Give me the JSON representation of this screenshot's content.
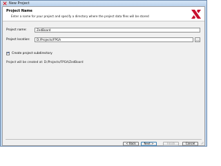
{
  "window": {
    "title": "New Project",
    "icon": "xilinx-ise-icon"
  },
  "header": {
    "title": "Project Name",
    "description": "Enter a name for your project and specify a directory where the project data files will be stored",
    "logo": "xilinx-logo"
  },
  "form": {
    "project_name_label": "Project name:",
    "project_name_value": "ZedBoard",
    "project_location_label": "Project location:",
    "project_location_value": "D:/Projects/FPGA",
    "browse_label": "...",
    "subdirectory_label": "Create project subdirectory",
    "subdirectory_checked": true,
    "created_at_note": "Project will be created at: D:/Projects/FPGA/ZedBoard"
  },
  "buttons": {
    "back": "< Back",
    "next": "Next >",
    "finish": "Finish",
    "cancel": "Cancel"
  },
  "colors": {
    "title_bar": "#b9d1ec",
    "logo_red": "#c8102e",
    "default_button_border": "#3c7fb1"
  }
}
